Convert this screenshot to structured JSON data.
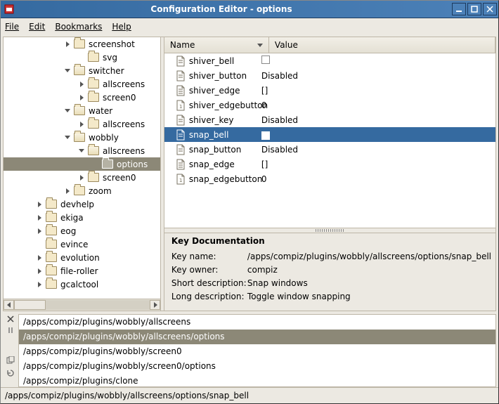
{
  "window": {
    "title": "Configuration Editor - options"
  },
  "menu": {
    "file": "File",
    "edit": "Edit",
    "bookmarks": "Bookmarks",
    "help": "Help"
  },
  "tree": {
    "items": [
      {
        "depth": 4,
        "arrow": "right",
        "label": "screenshot",
        "open": false
      },
      {
        "depth": 5,
        "arrow": "none",
        "label": "svg",
        "open": false
      },
      {
        "depth": 4,
        "arrow": "down",
        "label": "switcher",
        "open": true
      },
      {
        "depth": 5,
        "arrow": "right",
        "label": "allscreens",
        "open": false
      },
      {
        "depth": 5,
        "arrow": "right",
        "label": "screen0",
        "open": false
      },
      {
        "depth": 4,
        "arrow": "down",
        "label": "water",
        "open": true
      },
      {
        "depth": 5,
        "arrow": "right",
        "label": "allscreens",
        "open": false
      },
      {
        "depth": 4,
        "arrow": "down",
        "label": "wobbly",
        "open": true
      },
      {
        "depth": 5,
        "arrow": "down",
        "label": "allscreens",
        "open": true
      },
      {
        "depth": 6,
        "arrow": "none",
        "label": "options",
        "open": false,
        "selected": true
      },
      {
        "depth": 5,
        "arrow": "right",
        "label": "screen0",
        "open": false
      },
      {
        "depth": 4,
        "arrow": "right",
        "label": "zoom",
        "open": false
      },
      {
        "depth": 2,
        "arrow": "right",
        "label": "devhelp",
        "open": false
      },
      {
        "depth": 2,
        "arrow": "right",
        "label": "ekiga",
        "open": false
      },
      {
        "depth": 2,
        "arrow": "right",
        "label": "eog",
        "open": false
      },
      {
        "depth": 2,
        "arrow": "none",
        "label": "evince",
        "open": false
      },
      {
        "depth": 2,
        "arrow": "right",
        "label": "evolution",
        "open": false
      },
      {
        "depth": 2,
        "arrow": "right",
        "label": "file-roller",
        "open": false
      },
      {
        "depth": 2,
        "arrow": "right",
        "label": "gcalctool",
        "open": false
      }
    ]
  },
  "list": {
    "name_header": "Name",
    "value_header": "Value",
    "rows": [
      {
        "type": "bool",
        "name": "shiver_bell",
        "value": ""
      },
      {
        "type": "str",
        "name": "shiver_button",
        "value": "Disabled"
      },
      {
        "type": "list",
        "name": "shiver_edge",
        "value": "[]"
      },
      {
        "type": "int",
        "name": "shiver_edgebutton",
        "value": "0"
      },
      {
        "type": "str",
        "name": "shiver_key",
        "value": "Disabled"
      },
      {
        "type": "bool",
        "name": "snap_bell",
        "value": "checked",
        "selected": true
      },
      {
        "type": "str",
        "name": "snap_button",
        "value": "Disabled"
      },
      {
        "type": "list",
        "name": "snap_edge",
        "value": "[]"
      },
      {
        "type": "int",
        "name": "snap_edgebutton",
        "value": "0"
      }
    ]
  },
  "doc": {
    "title": "Key Documentation",
    "keyname_label": "Key name:",
    "keyname": "/apps/compiz/plugins/wobbly/allscreens/options/snap_bell",
    "keyowner_label": "Key owner:",
    "keyowner": "compiz",
    "short_label": "Short description:",
    "short": "Snap windows",
    "long_label": "Long description:",
    "long": "Toggle window snapping"
  },
  "recent": {
    "items": [
      {
        "path": "/apps/compiz/plugins/wobbly/allscreens"
      },
      {
        "path": "/apps/compiz/plugins/wobbly/allscreens/options",
        "selected": true
      },
      {
        "path": "/apps/compiz/plugins/wobbly/screen0"
      },
      {
        "path": "/apps/compiz/plugins/wobbly/screen0/options"
      },
      {
        "path": "/apps/compiz/plugins/clone"
      }
    ]
  },
  "status": {
    "path": "/apps/compiz/plugins/wobbly/allscreens/options/snap_bell"
  }
}
